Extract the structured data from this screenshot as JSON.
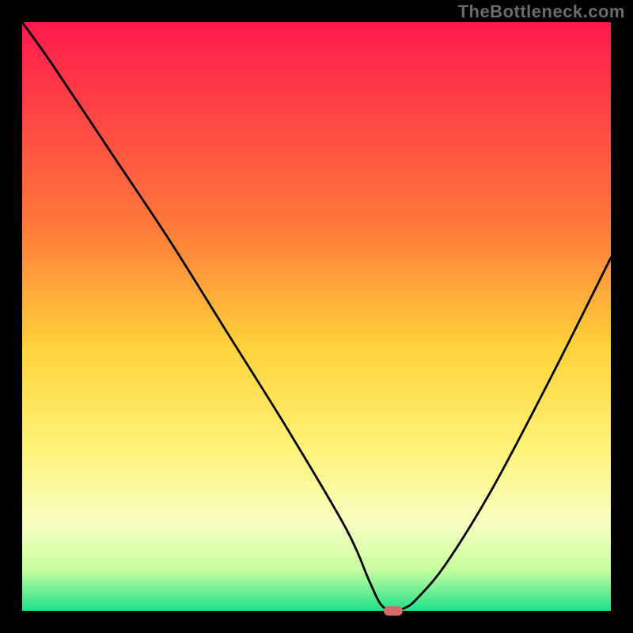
{
  "watermark": "TheBottleneck.com",
  "chart_data": {
    "type": "line",
    "title": "",
    "xlabel": "",
    "ylabel": "",
    "xlim": [
      0,
      100
    ],
    "ylim": [
      0,
      100
    ],
    "grid": false,
    "legend": false,
    "background": {
      "type": "vertical-gradient-traffic-light",
      "stops": [
        {
          "offset": 0.0,
          "color": "#ff1a4d"
        },
        {
          "offset": 0.35,
          "color": "#ff7a3a"
        },
        {
          "offset": 0.55,
          "color": "#ffd23a"
        },
        {
          "offset": 0.72,
          "color": "#fff275"
        },
        {
          "offset": 0.85,
          "color": "#f8ffc2"
        },
        {
          "offset": 0.93,
          "color": "#c8ff9e"
        },
        {
          "offset": 1.0,
          "color": "#1fe08a"
        }
      ]
    },
    "optimum": {
      "x": 63,
      "y": 0
    },
    "x": [
      0,
      5,
      15,
      25,
      35,
      45,
      55,
      59,
      61,
      63,
      65,
      67,
      72,
      80,
      90,
      100
    ],
    "values": [
      100,
      93,
      78,
      63,
      47,
      31,
      14,
      5,
      1,
      0,
      0.5,
      2,
      8,
      21,
      40,
      60
    ],
    "series_name": "bottleneck-curve"
  },
  "colors": {
    "curve": "#000000",
    "frame": "#000000",
    "optimum_marker": "#d56a6a"
  }
}
